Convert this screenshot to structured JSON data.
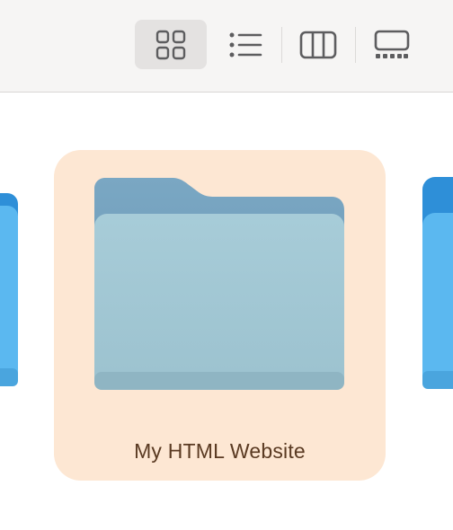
{
  "toolbar": {
    "views": [
      {
        "name": "icon-view",
        "icon": "grid-icon",
        "active": true
      },
      {
        "name": "list-view",
        "icon": "list-icon",
        "active": false
      },
      {
        "name": "column-view",
        "icon": "columns-icon",
        "active": false
      },
      {
        "name": "gallery-view",
        "icon": "gallery-icon",
        "active": false
      }
    ]
  },
  "content": {
    "selected_item": {
      "label": "My HTML Website",
      "icon": "folder-icon"
    }
  },
  "colors": {
    "selection_bg": "#fde7d3",
    "folder_selected": "#a2c6d3",
    "folder_default": "#5bb8f0",
    "label_color": "#5a3a22"
  }
}
